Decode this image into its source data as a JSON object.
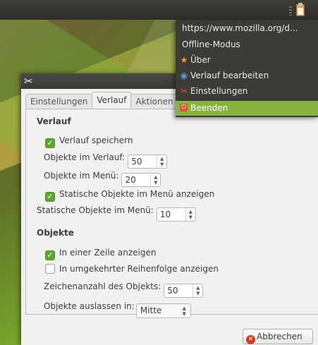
{
  "menu": {
    "items": [
      {
        "label": "https://www.mozilla.org/d...",
        "icon": ""
      },
      {
        "label": "Offline-Modus",
        "icon": ""
      },
      {
        "label": "Über",
        "icon": "star-icon"
      },
      {
        "label": "Verlauf bearbeiten",
        "icon": "history-icon"
      },
      {
        "label": "Einstellungen",
        "icon": "settings-tools-icon"
      },
      {
        "label": "Beenden",
        "icon": "power-icon"
      }
    ],
    "highlighted": "Beenden",
    "highlight_color": "#88b33e"
  },
  "dialog": {
    "tabs": [
      "Einstellungen",
      "Verlauf",
      "Aktionen"
    ],
    "active_tab": "Verlauf",
    "verlauf": {
      "heading": "Verlauf",
      "save_history_label": "Verlauf speichern",
      "save_history_checked": true,
      "items_in_history_label": "Objekte im Verlauf:",
      "items_in_history_value": "50",
      "items_in_menu_label": "Objekte im Menü:",
      "items_in_menu_value": "20",
      "show_static_label": "Statische Objekte im Menü anzeigen",
      "show_static_checked": true,
      "static_items_label": "Statische Objekte im Menü:",
      "static_items_value": "10"
    },
    "objekte": {
      "heading": "Objekte",
      "single_line_label": "In einer Zeile anzeigen",
      "single_line_checked": true,
      "reverse_order_label": "In umgekehrter Reihenfolge anzeigen",
      "reverse_order_checked": false,
      "char_count_label": "Zeichenanzahl des Objekts:",
      "char_count_value": "50",
      "omit_label": "Objekte auslassen in:",
      "omit_value": "Mitte"
    },
    "cancel_label": "Abbrechen"
  },
  "colors": {
    "accent_green": "#61a534",
    "panel_dark": "#3c3b37",
    "cancel_red": "#d23a24"
  }
}
